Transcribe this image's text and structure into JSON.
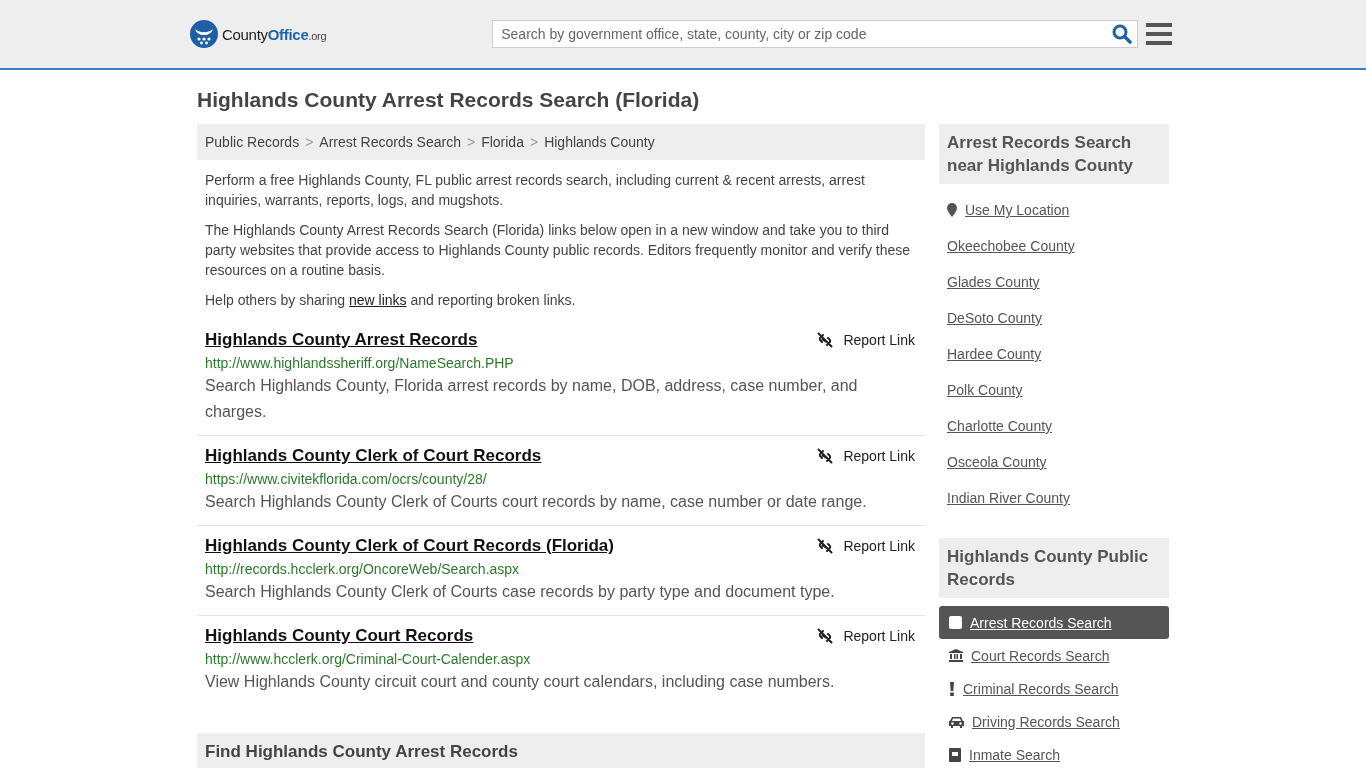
{
  "header": {
    "logo": {
      "part1": "County",
      "part2": "Office",
      "suffix": ".org"
    },
    "search": {
      "placeholder": "Search by government office, state, county, city or zip code"
    }
  },
  "page_title": "Highlands County Arrest Records Search (Florida)",
  "breadcrumbs": {
    "items": [
      "Public Records",
      "Arrest Records Search",
      "Florida",
      "Highlands County"
    ],
    "separators": [
      ">",
      ">",
      ">"
    ]
  },
  "intro": [
    "Perform a free Highlands County, FL public arrest records search, including current & recent arrests, arrest inquiries, warrants, reports, logs, and mugshots.",
    "The Highlands County Arrest Records Search (Florida) links below open in a new window and take you to third party websites that provide access to Highlands County public records. Editors frequently monitor and verify these resources on a routine basis."
  ],
  "share": {
    "before": "Help others by sharing ",
    "link": "new links",
    "after": " and reporting broken links."
  },
  "records": [
    {
      "title": "Highlands County Arrest Records",
      "url": "http://www.highlandssheriff.org/NameSearch.PHP",
      "description": "Search Highlands County, Florida arrest records by name, DOB, address, case number, and charges.",
      "report": "Report Link"
    },
    {
      "title": "Highlands County Clerk of Court Records",
      "url": "https://www.civitekflorida.com/ocrs/county/28/",
      "description": "Search Highlands County Clerk of Courts court records by name, case number or date range.",
      "report": "Report Link"
    },
    {
      "title": "Highlands County Clerk of Court Records (Florida)",
      "url": "http://records.hcclerk.org/OncoreWeb/Search.aspx",
      "description": "Search Highlands County Clerk of Courts case records by party type and document type.",
      "report": "Report Link"
    },
    {
      "title": "Highlands County Court Records",
      "url": "http://www.hcclerk.org/Criminal-Court-Calender.aspx",
      "description": "View Highlands County circuit court and county court calendars, including case numbers.",
      "report": "Report Link"
    }
  ],
  "find_section": {
    "title": "Find Highlands County Arrest Records"
  },
  "sidebar": {
    "nearby": {
      "title": "Arrest Records Search near Highlands County",
      "location": "Use My Location",
      "items": [
        "Okeechobee County",
        "Glades County",
        "DeSoto County",
        "Hardee County",
        "Polk County",
        "Charlotte County",
        "Osceola County",
        "Indian River County"
      ]
    },
    "public_records": {
      "title": "Highlands County Public Records",
      "items": [
        {
          "label": "Arrest Records Search",
          "kind": "square",
          "selected": true
        },
        {
          "label": "Court Records Search",
          "kind": "bank",
          "selected": false
        },
        {
          "label": "Criminal Records Search",
          "kind": "exclamation",
          "selected": false
        },
        {
          "label": "Driving Records Search",
          "kind": "car",
          "selected": false
        },
        {
          "label": "Inmate Search",
          "kind": "id",
          "selected": false
        }
      ]
    }
  }
}
